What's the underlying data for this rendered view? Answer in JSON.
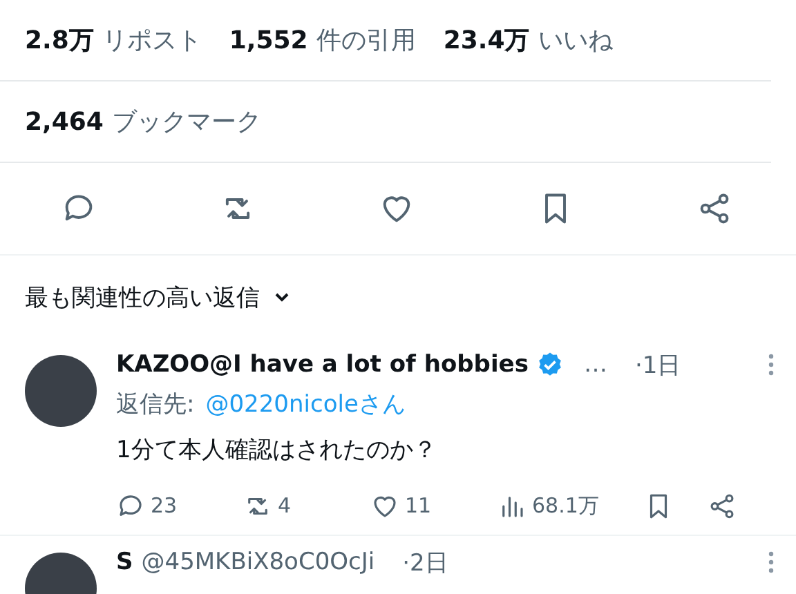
{
  "stats": [
    {
      "count": "2.8万",
      "label": "リポスト"
    },
    {
      "count": "1,552",
      "label": "件の引用"
    },
    {
      "count": "23.4万",
      "label": "いいね"
    }
  ],
  "bookmarks": {
    "count": "2,464",
    "label": "ブックマーク"
  },
  "actions": [
    {
      "kind": "reply"
    },
    {
      "kind": "repost"
    },
    {
      "kind": "like"
    },
    {
      "kind": "bookmark"
    },
    {
      "kind": "share"
    }
  ],
  "sort": {
    "label": "最も関連性の高い返信"
  },
  "replies": [
    {
      "name": "KAZOO@I have a lot of hobbies",
      "verified": true,
      "more": "…",
      "time": "·1日",
      "reply_to_label": "返信先:",
      "reply_to": "@0220nicoleさん",
      "text": "1分て本人確認はされたのか？",
      "counts": {
        "reply": "23",
        "repost": "4",
        "like": "11",
        "views": "68.1万"
      }
    },
    {
      "name": "S",
      "handle": "@45MKBiX8oC0OcJi",
      "time": "·2日"
    }
  ]
}
